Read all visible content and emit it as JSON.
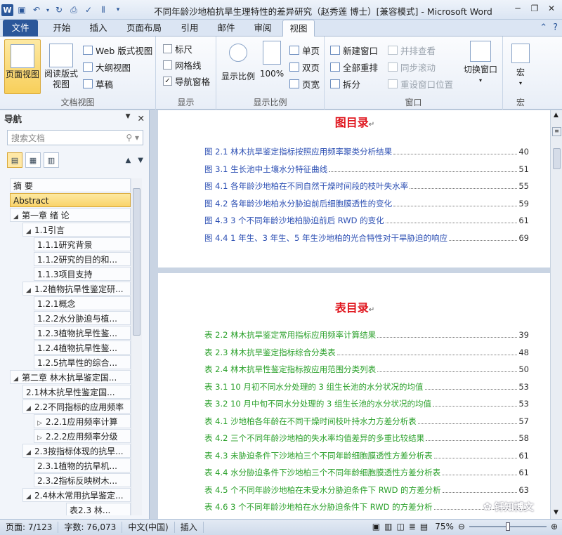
{
  "window": {
    "title": "不同年龄沙地柏抗旱生理特性的差异研究（赵秀莲 博士）[兼容模式] - Microsoft Word"
  },
  "tabs": [
    "文件",
    "开始",
    "插入",
    "页面布局",
    "引用",
    "邮件",
    "审阅",
    "视图"
  ],
  "active_tab": "视图",
  "ribbon": {
    "doc_views": {
      "label": "文档视图",
      "page_view": "页面视图",
      "read_view_1": "阅读版式",
      "read_view_2": "视图",
      "web_view": "Web 版式视图",
      "outline": "大纲视图",
      "draft": "草稿"
    },
    "show": {
      "label": "显示",
      "ruler": "标尺",
      "gridlines": "网格线",
      "nav_pane": "导航窗格",
      "nav_pane_checked": true
    },
    "zoom": {
      "label": "显示比例",
      "zoom_btn": "显示比例",
      "hundred": "100%",
      "one_page": "单页",
      "two_pages": "双页",
      "page_width": "页宽"
    },
    "window": {
      "label": "窗口",
      "new_window": "新建窗口",
      "arrange_all": "全部重排",
      "split": "拆分",
      "side_by_side": "并排查看",
      "sync_scroll": "同步滚动",
      "reset_pos": "重设窗口位置",
      "switch_windows": "切换窗口"
    },
    "macros": {
      "label": "宏",
      "macros_btn": "宏"
    }
  },
  "nav": {
    "title": "导航",
    "search_placeholder": "搜索文档",
    "items": [
      {
        "text": "摘  要",
        "level": 0,
        "twisty": "",
        "highlight": false
      },
      {
        "text": "Abstract",
        "level": 0,
        "twisty": "",
        "highlight": true
      },
      {
        "text": "第一章  绪  论",
        "level": 0,
        "twisty": "◢",
        "highlight": false
      },
      {
        "text": "1.1引言",
        "level": 1,
        "twisty": "◢",
        "highlight": false
      },
      {
        "text": "1.1.1研究背景",
        "level": 2,
        "twisty": "",
        "highlight": false
      },
      {
        "text": "1.1.2研究的目的和...",
        "level": 2,
        "twisty": "",
        "highlight": false
      },
      {
        "text": "1.1.3项目支持",
        "level": 2,
        "twisty": "",
        "highlight": false
      },
      {
        "text": "1.2植物抗旱性鉴定研...",
        "level": 1,
        "twisty": "◢",
        "highlight": false
      },
      {
        "text": "1.2.1概念",
        "level": 2,
        "twisty": "",
        "highlight": false
      },
      {
        "text": "1.2.2水分胁迫与植...",
        "level": 2,
        "twisty": "",
        "highlight": false
      },
      {
        "text": "1.2.3植物抗旱性鉴...",
        "level": 2,
        "twisty": "",
        "highlight": false
      },
      {
        "text": "1.2.4植物抗旱性鉴...",
        "level": 2,
        "twisty": "",
        "highlight": false
      },
      {
        "text": "1.2.5抗旱性的综合...",
        "level": 2,
        "twisty": "",
        "highlight": false
      },
      {
        "text": "第二章  林木抗旱鉴定国...",
        "level": 0,
        "twisty": "◢",
        "highlight": false
      },
      {
        "text": "2.1林木抗旱性鉴定国...",
        "level": 1,
        "twisty": "",
        "highlight": false
      },
      {
        "text": "2.2不同指标的应用频率",
        "level": 1,
        "twisty": "◢",
        "highlight": false
      },
      {
        "text": "2.2.1应用频率计算",
        "level": 2,
        "twisty": "▷",
        "highlight": false
      },
      {
        "text": "2.2.2应用频率分级",
        "level": 2,
        "twisty": "▷",
        "highlight": false
      },
      {
        "text": "2.3按指标体现的抗旱...",
        "level": 1,
        "twisty": "◢",
        "highlight": false
      },
      {
        "text": "2.3.1植物的抗旱机...",
        "level": 2,
        "twisty": "",
        "highlight": false
      },
      {
        "text": "2.3.2指标反映树木...",
        "level": 2,
        "twisty": "",
        "highlight": false
      },
      {
        "text": "2.4林木常用抗旱鉴定...",
        "level": 1,
        "twisty": "◢",
        "highlight": false
      },
      {
        "text": "表2.3  林...",
        "level": 3,
        "twisty": "",
        "highlight": false
      }
    ]
  },
  "figures_page": {
    "title": "图目录",
    "entries": [
      {
        "label": "图 2.1 林木抗旱鉴定指标按照应用频率聚类分析结果",
        "page": "40"
      },
      {
        "label": "图 3.1 生长池中土壤水分特征曲线",
        "page": "51"
      },
      {
        "label": "图 4.1  各年龄沙地柏在不同自然干燥时间段的枝叶失水率",
        "page": "55"
      },
      {
        "label": "图 4.2 各年龄沙地柏水分胁迫前后细胞膜透性的变化",
        "page": "59"
      },
      {
        "label": "图 4.3      3 个不同年龄沙地柏胁迫前后 RWD 的变化",
        "page": "61"
      },
      {
        "label": "图 4.4      1 年生、3 年生、5 年生沙地柏的光合特性对干旱胁迫的响应",
        "page": "69"
      }
    ]
  },
  "tables_page": {
    "title": "表目录",
    "entries": [
      {
        "label": "表 2.2 林木抗旱鉴定常用指标应用频率计算结果",
        "page": "39"
      },
      {
        "label": "表 2.3  林木抗旱鉴定指标综合分类表",
        "page": "48"
      },
      {
        "label": "表 2.4 林木抗旱性鉴定指标按应用范围分类列表",
        "page": "50"
      },
      {
        "label": "表 3.1    10 月初不同水分处理的 3 组生长池的水分状况的均值",
        "page": "53"
      },
      {
        "label": "表 3.2    10 月中旬不同水分处理的 3 组生长池的水分状况的均值",
        "page": "53"
      },
      {
        "label": "表 4.1    沙地柏各年龄在不同干燥时间枝叶持水力方差分析表",
        "page": "57"
      },
      {
        "label": "表 4.2     三个不同年龄沙地柏的失水率均值差异的多重比较结果",
        "page": "58"
      },
      {
        "label": "表 4.3  未胁迫条件下沙地柏三个不同年龄细胞膜透性方差分析表",
        "page": "61"
      },
      {
        "label": "表 4.4 水分胁迫条件下沙地柏三个不同年龄细胞膜透性方差分析表",
        "page": "61"
      },
      {
        "label": "表 4.5 个不同年龄沙地柏在未受水分胁迫条件下 RWD 的方差分析",
        "page": "63"
      },
      {
        "label": "表 4.6    3 个不同年龄沙地柏在水分胁迫条件下 RWD 的方差分析",
        "page": ""
      }
    ]
  },
  "status": {
    "page": "页面: 7/123",
    "words": "字数: 76,073",
    "lang": "中文(中国)",
    "insert": "插入",
    "zoom": "75%",
    "zoom_level": 0.5
  },
  "watermark": "钎知博文",
  "colors": {
    "file_tab": "#2b579a",
    "toc_title": "#e0161e",
    "figure_entry": "#2c4fb3",
    "table_entry": "#2aa02a",
    "highlight": "#f9d36a"
  }
}
